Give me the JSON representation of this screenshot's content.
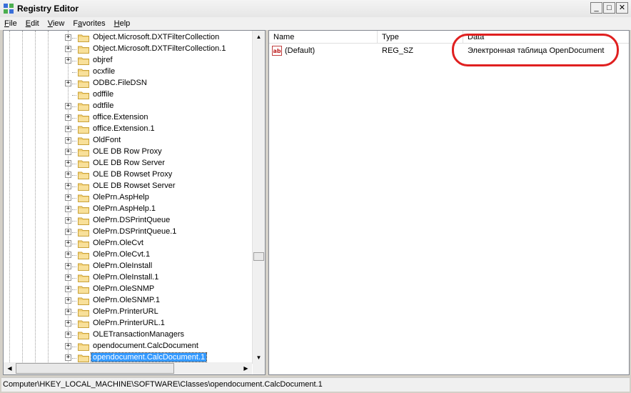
{
  "window": {
    "title": "Registry Editor"
  },
  "window_controls": {
    "minimize": "_",
    "maximize": "□",
    "close": "✕"
  },
  "menu": [
    {
      "label": "File",
      "accel": "F",
      "rest": "ile"
    },
    {
      "label": "Edit",
      "accel": "E",
      "rest": "dit"
    },
    {
      "label": "View",
      "accel": "V",
      "rest": "iew"
    },
    {
      "label": "Favorites",
      "accel": "a",
      "pre": "F",
      "rest": "vorites"
    },
    {
      "label": "Help",
      "accel": "H",
      "rest": "elp"
    }
  ],
  "tree": {
    "items": [
      {
        "label": "Object.Microsoft.DXTFilterCollection",
        "expandable": true
      },
      {
        "label": "Object.Microsoft.DXTFilterCollection.1",
        "expandable": true
      },
      {
        "label": "objref",
        "expandable": true
      },
      {
        "label": "ocxfile",
        "expandable": false
      },
      {
        "label": "ODBC.FileDSN",
        "expandable": true
      },
      {
        "label": "odffile",
        "expandable": false
      },
      {
        "label": "odtfile",
        "expandable": true
      },
      {
        "label": "office.Extension",
        "expandable": true
      },
      {
        "label": "office.Extension.1",
        "expandable": true
      },
      {
        "label": "OldFont",
        "expandable": true
      },
      {
        "label": "OLE DB Row Proxy",
        "expandable": true
      },
      {
        "label": "OLE DB Row Server",
        "expandable": true
      },
      {
        "label": "OLE DB Rowset Proxy",
        "expandable": true
      },
      {
        "label": "OLE DB Rowset Server",
        "expandable": true
      },
      {
        "label": "OlePrn.AspHelp",
        "expandable": true
      },
      {
        "label": "OlePrn.AspHelp.1",
        "expandable": true
      },
      {
        "label": "OlePrn.DSPrintQueue",
        "expandable": true
      },
      {
        "label": "OlePrn.DSPrintQueue.1",
        "expandable": true
      },
      {
        "label": "OlePrn.OleCvt",
        "expandable": true
      },
      {
        "label": "OlePrn.OleCvt.1",
        "expandable": true
      },
      {
        "label": "OlePrn.OleInstall",
        "expandable": true
      },
      {
        "label": "OlePrn.OleInstall.1",
        "expandable": true
      },
      {
        "label": "OlePrn.OleSNMP",
        "expandable": true
      },
      {
        "label": "OlePrn.OleSNMP.1",
        "expandable": true
      },
      {
        "label": "OlePrn.PrinterURL",
        "expandable": true
      },
      {
        "label": "OlePrn.PrinterURL.1",
        "expandable": true
      },
      {
        "label": "OLETransactionManagers",
        "expandable": true
      },
      {
        "label": "opendocument.CalcDocument",
        "expandable": true
      },
      {
        "label": "opendocument.CalcDocument.1",
        "expandable": true,
        "selected": true
      }
    ]
  },
  "list": {
    "columns": [
      "Name",
      "Type",
      "Data"
    ],
    "rows": [
      {
        "name": "(Default)",
        "type": "REG_SZ",
        "data": "Электронная таблица OpenDocument",
        "icon": "string-value-icon"
      }
    ]
  },
  "status": {
    "path": "Computer\\HKEY_LOCAL_MACHINE\\SOFTWARE\\Classes\\opendocument.CalcDocument.1"
  },
  "colors": {
    "selection": "#3399ff",
    "annotation": "#e02020"
  }
}
